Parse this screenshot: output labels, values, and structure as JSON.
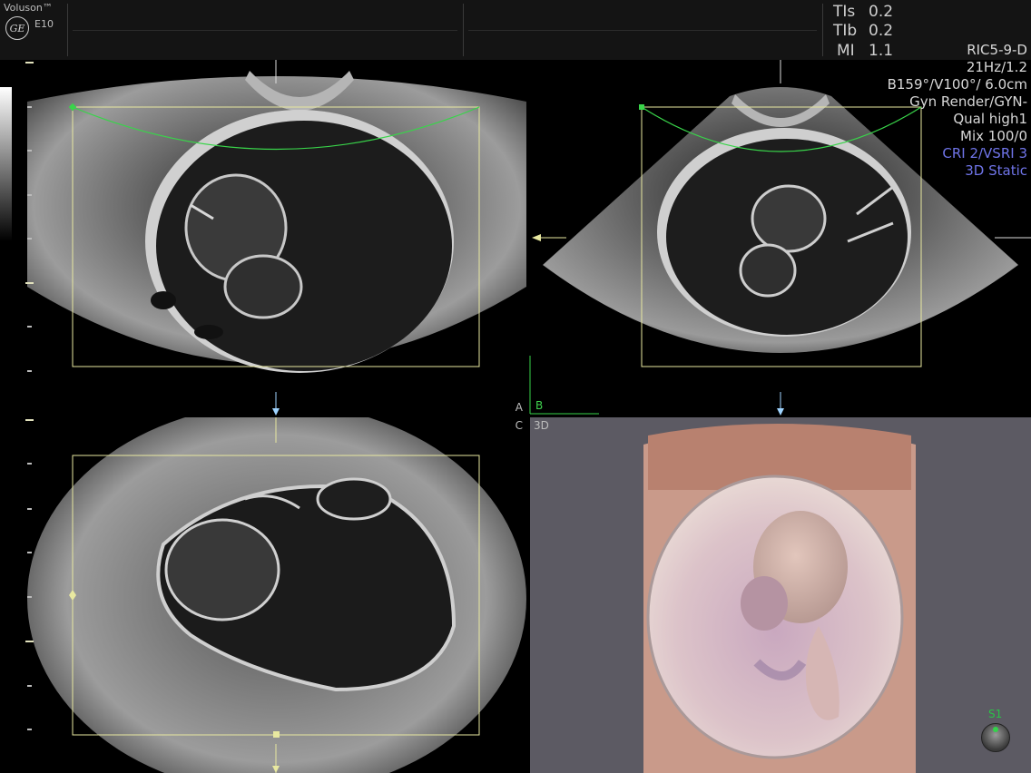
{
  "system": {
    "brand": "Voluson™",
    "logo_text": "GE",
    "model": "E10"
  },
  "indices": {
    "tis": "TIs",
    "tis_value": "0.2",
    "tib": "TIb",
    "tib_value": "0.2",
    "mi": "MI",
    "mi_value": "1.1"
  },
  "params": {
    "probe": "RIC5-9-D",
    "frame_rate": "21Hz/1.2",
    "angles": "B159°/V100°/ 6.0cm",
    "render_mode": "Gyn Render/GYN-",
    "quality": "Qual high1",
    "mix": "Mix 100/0",
    "cri": "CRI 2/VSRI 3",
    "static_mode": "3D Static"
  },
  "quadrants": {
    "a": "A",
    "b": "B",
    "c": "C",
    "d": "3D"
  },
  "control": {
    "label": "S1"
  },
  "colors": {
    "roi_box": "#e8e8a0",
    "render_line": "#39d44a",
    "accent": "#6f74e8",
    "ref_marker": "#9fd4ff"
  }
}
